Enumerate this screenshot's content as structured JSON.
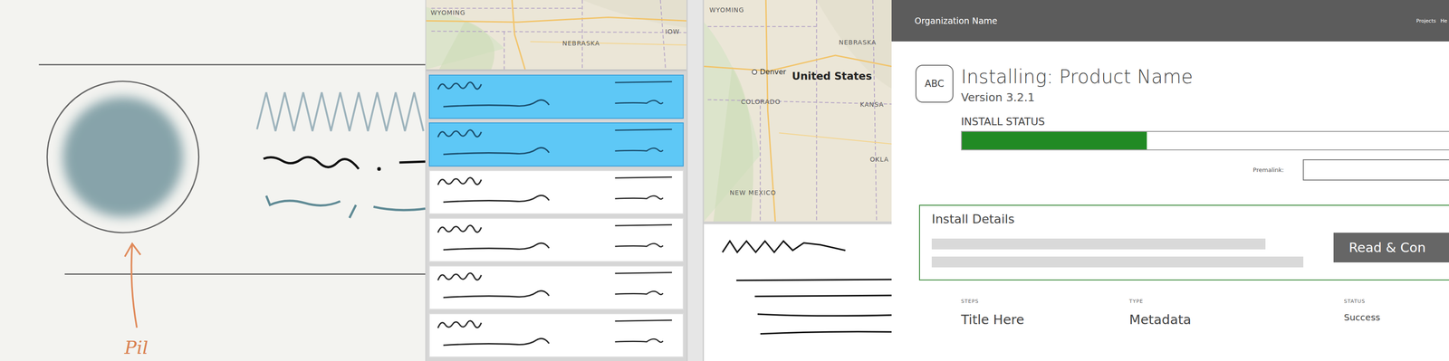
{
  "sketch_canvas": {
    "annotation": "Pil"
  },
  "list_panel": {
    "map": {
      "labels": [
        {
          "text": "WYOMING",
          "kind": "state"
        },
        {
          "text": "NEBRASKA",
          "kind": "state"
        },
        {
          "text": "IOW",
          "kind": "state"
        }
      ]
    },
    "items": [
      {
        "selected": true
      },
      {
        "selected": true
      },
      {
        "selected": false
      },
      {
        "selected": false
      },
      {
        "selected": false
      },
      {
        "selected": false
      }
    ]
  },
  "map_panel": {
    "map": {
      "labels": [
        {
          "text": "WYOMING",
          "kind": "state"
        },
        {
          "text": "NEBRASKA",
          "kind": "state"
        },
        {
          "text": "Denver",
          "kind": "city"
        },
        {
          "text": "United States",
          "kind": "country"
        },
        {
          "text": "COLORADO",
          "kind": "state"
        },
        {
          "text": "KANSA",
          "kind": "state"
        },
        {
          "text": "OKLA",
          "kind": "state"
        },
        {
          "text": "NEW MEXICO",
          "kind": "state"
        }
      ]
    }
  },
  "installer": {
    "header": {
      "organization": "Organization Name",
      "nav": [
        "Projects",
        "He"
      ]
    },
    "logo": "ABC",
    "title": "Installing: Product Name",
    "version": "Version 3.2.1",
    "status_label": "INSTALL STATUS",
    "progress": {
      "level": 0.38
    },
    "permalink": {
      "label": "Premalink:",
      "value": ""
    },
    "details": {
      "title": "Install Details",
      "button": "Read & Con"
    },
    "table": {
      "columns": [
        "STEPS",
        "TYPE",
        "STATUS"
      ],
      "rows": [
        [
          "Title Here",
          "Metadata",
          "Success"
        ]
      ]
    }
  }
}
